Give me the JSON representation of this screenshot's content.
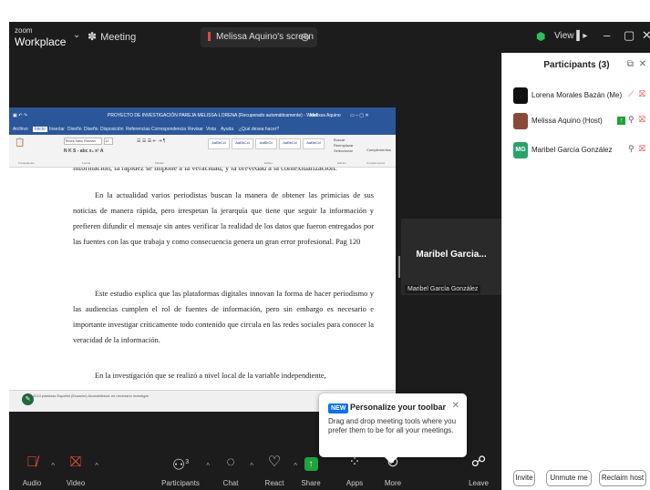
{
  "titlebar": {
    "logo_small": "zoom",
    "logo_big": "Workplace",
    "meeting_label": "Meeting",
    "screen_label": "Melissa Aquino's screen",
    "view_label": "View"
  },
  "word": {
    "title": "PROYECTO DE INVESTIGACIÓN PAREJA MELISSA-LORENA (Recuperado automáticamente) - Word",
    "user": "Melissa Aquino",
    "search_hint": "¿Qué desea hacer?",
    "tabs": [
      "Archivo",
      "Inicio",
      "Insertar",
      "Diseño",
      "Diseño",
      "Disposición",
      "Referencias",
      "Correspondencia",
      "Revisar",
      "Vista",
      "Ayuda"
    ],
    "font_name": "Times New Roman",
    "font_size": "12",
    "styles": [
      "AaBbCcl",
      "AaBbCcl",
      "AaBbCc",
      "AaBbCcl",
      "AaBbCcl"
    ],
    "style_names": [
      "1 Normal",
      "1 Sin espa...",
      "Título 1",
      "Título 2",
      "Título 3"
    ],
    "groups": [
      "Portapapeles",
      "Fuente",
      "Párrafo",
      "Estilos",
      "Edición",
      "Complementos"
    ],
    "editing": [
      "Buscar",
      "Reemplazar",
      "Seleccionar"
    ],
    "addins": "Complementos",
    "paragraphs": [
      "información, la rapidez se impone a la veracidad, y la brevedad a la contextualización.",
      "En la actualidad varios periodistas buscan la manera de obtener las primicias de sus noticias de manera rápida, pero irrespetan la jerarquía que tiene que seguir la información y prefieren difundir el mensaje sin antes verificar la realidad de los datos que fueron entregados por las fuentes con las que trabaja y como consecuencia genera un gran error profesional. Pag 120",
      "Este estudio explica que las plataformas digitales innovan la forma de hacer periodismo y las audiencias cumplen el rol de fuentes de información, pero sin embargo es necesario e importante investigar críticamente todo contenido que circula en las redes sociales para conocer la veracidad de la información.",
      "En la investigación que se realizó a nivel local de la variable independiente,"
    ],
    "status_text": "4213 palabras  Español (Ecuador)  Accesibilidad: es necesario investigar"
  },
  "tile": {
    "name_big": "Maribel Garcia...",
    "name_small": "Maribel García González"
  },
  "toolbar": {
    "items": [
      {
        "label": "Audio",
        "icon": "mic-muted-icon"
      },
      {
        "label": "Video",
        "icon": "video-off-icon"
      },
      {
        "label": "Participants",
        "icon": "participants-icon",
        "count": "3"
      },
      {
        "label": "Chat",
        "icon": "chat-icon"
      },
      {
        "label": "React",
        "icon": "heart-icon"
      },
      {
        "label": "Share",
        "icon": "share-icon"
      },
      {
        "label": "Apps",
        "icon": "apps-icon"
      },
      {
        "label": "More",
        "icon": "more-icon"
      },
      {
        "label": "Leave",
        "icon": "leave-icon"
      }
    ]
  },
  "tooltip": {
    "badge": "NEW",
    "title": "Personalize your toolbar",
    "body": "Drag and drop meeting tools where you prefer them to be for all your meetings."
  },
  "panel": {
    "title": "Participants (3)",
    "participants": [
      {
        "name": "Lorena Morales Bazán (Me)",
        "avatar_color": "#111111",
        "initials": ""
      },
      {
        "name": "Melissa Aquino (Host)",
        "avatar_color": "#8a4a3a",
        "initials": ""
      },
      {
        "name": "Maribel García González",
        "avatar_color": "#29a36a",
        "initials": "MG"
      }
    ],
    "buttons": {
      "invite": "Invite",
      "unmute": "Unmute me",
      "reclaim": "Reclaim host"
    }
  },
  "colors": {
    "zoom_dark": "#1c1c1c",
    "word_blue": "#2b579a",
    "muted_red": "#e0483c",
    "share_green": "#1fa33a",
    "zoom_blue": "#0e71eb"
  }
}
